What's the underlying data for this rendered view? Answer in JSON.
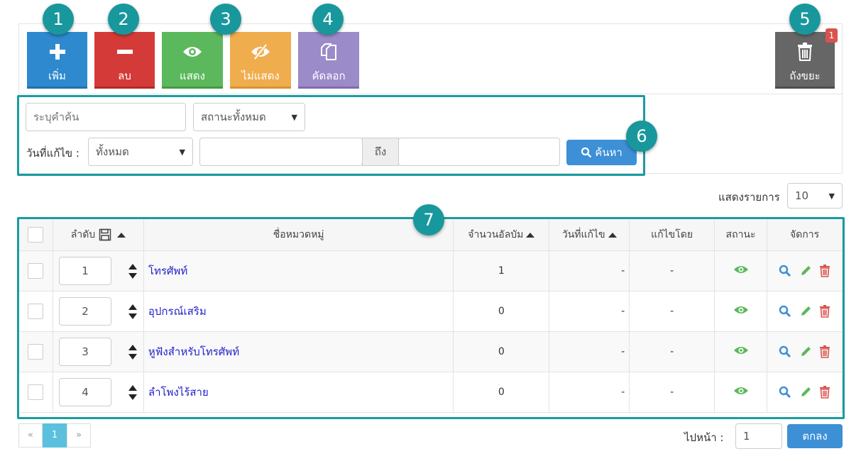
{
  "toolbar": {
    "add_label": "เพิ่ม",
    "delete_label": "ลบ",
    "show_label": "แสดง",
    "hide_label": "ไม่แสดง",
    "copy_label": "คัดลอก",
    "trash_label": "ถังขยะ",
    "trash_count": "1"
  },
  "callouts": [
    "1",
    "2",
    "3",
    "4",
    "5",
    "6",
    "7"
  ],
  "filter": {
    "search_placeholder": "ระบุคำค้น",
    "status_selected": "สถานะทั้งหมด",
    "date_label": "วันที่แก้ไข :",
    "date_selected": "ทั้งหมด",
    "to_label": "ถึง",
    "search_button": "ค้นหา"
  },
  "list": {
    "perpage_label": "แสดงรายการ",
    "perpage_value": "10"
  },
  "table": {
    "headers": {
      "order": "ลำดับ",
      "name": "ชื่อหมวดหมู่",
      "albums": "จำนวนอัลบัม",
      "modified": "วันที่แก้ไข",
      "modified_by": "แก้ไขโดย",
      "status": "สถานะ",
      "manage": "จัดการ"
    },
    "rows": [
      {
        "order": "1",
        "name": "โทรศัพท์",
        "albums": "1",
        "modified": "-",
        "modified_by": "-"
      },
      {
        "order": "2",
        "name": "อุปกรณ์เสริม",
        "albums": "0",
        "modified": "-",
        "modified_by": "-"
      },
      {
        "order": "3",
        "name": "หูฟังสำหรับโทรศัพท์",
        "albums": "0",
        "modified": "-",
        "modified_by": "-"
      },
      {
        "order": "4",
        "name": "ลำโพงไร้สาย",
        "albums": "0",
        "modified": "-",
        "modified_by": "-"
      }
    ]
  },
  "pagination": {
    "prev": "«",
    "current": "1",
    "next": "»",
    "goto_label": "ไปหน้า :",
    "goto_value": "1",
    "ok_button": "ตกลง"
  },
  "colors": {
    "add": "#2f89cf",
    "delete": "#d43b38",
    "show": "#5cb85c",
    "hide": "#f0ad4e",
    "copy": "#9b8bc8",
    "trash": "#666666",
    "callout": "#18989d",
    "link": "#2222cc",
    "eye": "#5cb85c",
    "search_icon": "#3d8fd6",
    "edit_icon": "#5cb85c",
    "delete_icon": "#d9534f"
  }
}
